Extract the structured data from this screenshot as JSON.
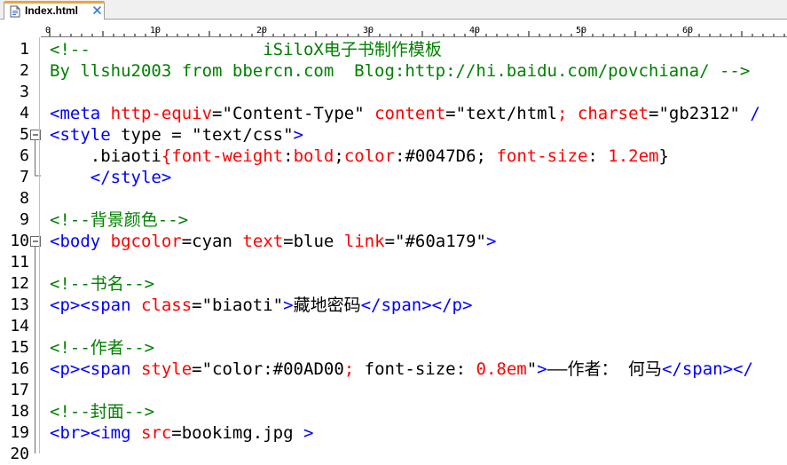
{
  "tab": {
    "title": "Index.html"
  },
  "ruler": {
    "labels": [
      "0",
      "10",
      "20",
      "30",
      "40",
      "50",
      "60"
    ]
  },
  "line_numbers": [
    "1",
    "2",
    "3",
    "4",
    "5",
    "6",
    "7",
    "8",
    "9",
    "10",
    "11",
    "12",
    "13",
    "14",
    "15",
    "16",
    "17",
    "18",
    "19",
    "20"
  ],
  "code": {
    "l1": {
      "a": "<!--",
      "b": "                 iSiloX电子书制作模板"
    },
    "l2": {
      "a": "By llshu2003 from bbercn.com  Blog:http://hi.baidu.com/povchiana/ -->"
    },
    "l3": {},
    "l4": {
      "a": "<meta",
      "b": " http-equiv",
      "c": "=",
      "d": "\"Content-Type\"",
      "e": " content",
      "f": "=",
      "g": "\"text/html",
      "h": ";",
      "i": " charset",
      "j": "=",
      "k": "\"gb2312\"",
      "l": " /"
    },
    "l5": {
      "a": "<style",
      "b": " type = ",
      "c": "\"text/css\"",
      "d": ">"
    },
    "l6": {
      "a": "    .biaoti",
      "b": "{",
      "c": "font-weight",
      "d": ":",
      "e": "bold",
      "f": ";",
      "g": "color",
      "h": ":",
      "i": "#0047D6",
      "j": ";",
      "k": " font-size",
      "l": ":",
      "m": " 1.2em",
      "n": "}"
    },
    "l7": {
      "a": "    </style>"
    },
    "l8": {},
    "l9": {
      "a": "<!--背景颜色-->"
    },
    "l10": {
      "a": "<body",
      "b": " bgcolor",
      "c": "=",
      "d": "cyan",
      "e": " text",
      "f": "=",
      "g": "blue",
      "h": " link",
      "i": "=",
      "j": "\"#60a179\"",
      "k": ">"
    },
    "l11": {},
    "l12": {
      "a": "<!--书名-->"
    },
    "l13": {
      "a": "<p><span",
      "b": " class",
      "c": "=",
      "d": "\"biaoti\"",
      "e": ">",
      "f": "藏地密码",
      "g": "</span></p>"
    },
    "l14": {},
    "l15": {
      "a": "<!--作者-->"
    },
    "l16": {
      "a": "<p><span",
      "b": " style",
      "c": "=",
      "d": "\"color:#00AD00",
      "e": ";",
      "f": " font-size: ",
      "g": "0.8em",
      "h": "\"",
      "i": ">",
      "j": "——作者： 何马",
      "k": "</span></"
    },
    "l17": {},
    "l18": {
      "a": "<!--封面-->"
    },
    "l19": {
      "a": "<br><img",
      "b": " src",
      "c": "=",
      "d": "bookimg.jpg",
      "e": " >"
    }
  },
  "colors": {
    "tag": "#0000ff",
    "attribute": "#ff0000",
    "comment": "#008000",
    "tab_accent": "#f2a23a"
  }
}
